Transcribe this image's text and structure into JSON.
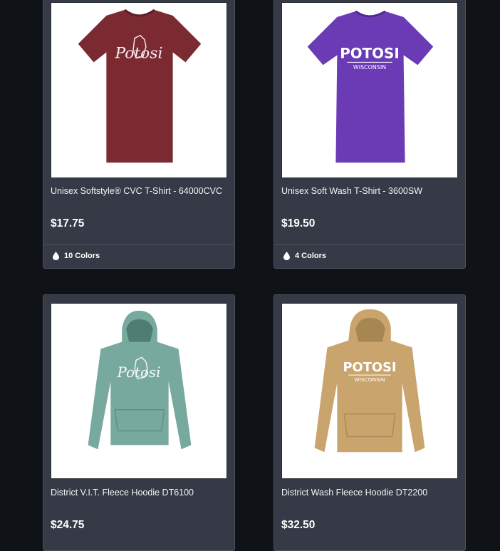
{
  "theme": {
    "background": "#0f1216",
    "card": "#353a46"
  },
  "products": [
    {
      "name": "Unisex Softstyle® CVC T-Shirt - 64000CVC",
      "price": "$17.75",
      "colors": "10 Colors",
      "garment": "maroon t-shirt",
      "garment_color": "#7b2a32",
      "print_text": "Potosi"
    },
    {
      "name": "Unisex Soft Wash T-Shirt - 3600SW",
      "price": "$19.50",
      "colors": "4 Colors",
      "garment": "purple t-shirt",
      "garment_color": "#6a3bb5",
      "print_text": "POTOSI",
      "print_subtext": "WISCONSIN"
    },
    {
      "name": "District V.I.T. Fleece Hoodie DT6100",
      "price": "$24.75",
      "garment": "sage hoodie",
      "garment_color": "#78a99f",
      "print_text": "Potosi"
    },
    {
      "name": "District Wash Fleece Hoodie DT2200",
      "price": "$32.50",
      "garment": "tan hoodie",
      "garment_color": "#c9a46d",
      "print_text": "POTOSI",
      "print_subtext": "WISCONSIN"
    }
  ],
  "icons": {
    "color_count": "droplet-icon"
  }
}
